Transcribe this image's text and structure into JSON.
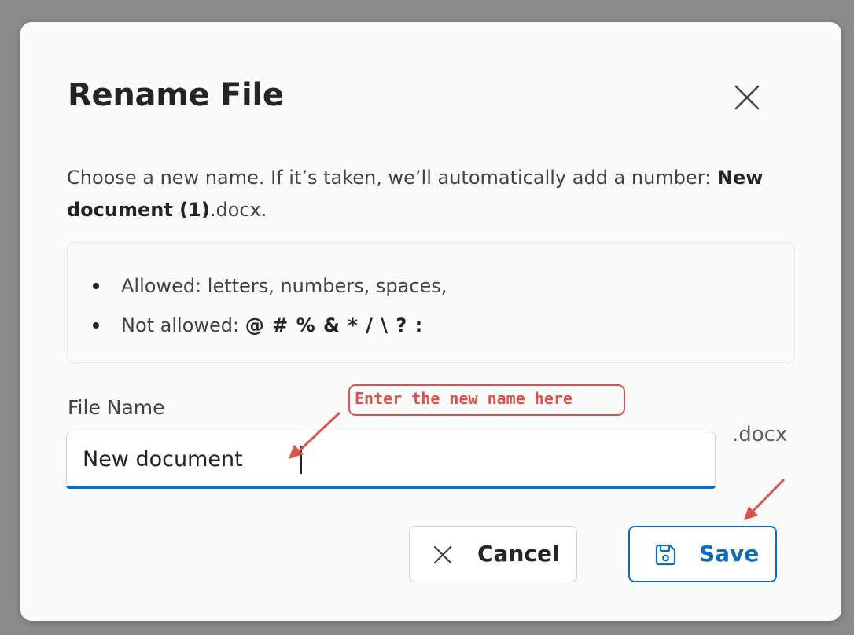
{
  "dialog": {
    "title": "Rename File",
    "description_prefix": "Choose a new name. If it’s taken, we’ll automatically add a number: ",
    "description_bold": "New document (1)",
    "description_suffix": ".docx.",
    "rules": [
      {
        "label": "Allowed: letters, numbers, spaces,",
        "bold": ""
      },
      {
        "label": "Not allowed: ",
        "bold": "@ # % & * / \\ ? :"
      }
    ],
    "field_label": "File Name",
    "input_value": "New document",
    "extension": ".docx",
    "cancel_label": "Cancel",
    "save_label": "Save"
  },
  "annotation": {
    "text": "Enter the new name here",
    "color": "#d9544a"
  },
  "colors": {
    "accent": "#0f6cbd",
    "text_primary": "#242424",
    "text_secondary": "#424242"
  },
  "icons": {
    "close": "close-icon",
    "cancel": "dismiss-icon",
    "save": "save-icon"
  }
}
